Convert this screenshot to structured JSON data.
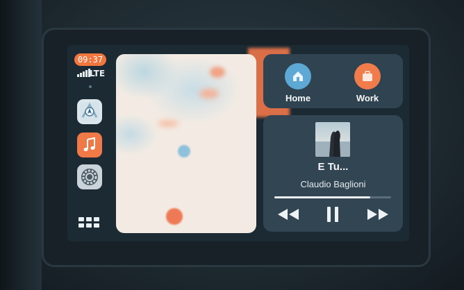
{
  "status": {
    "time": "09:37",
    "network": "LTE"
  },
  "dock": {
    "apps": [
      {
        "name": "Maps",
        "icon": "maps-icon"
      },
      {
        "name": "Music",
        "icon": "music-note-icon"
      },
      {
        "name": "Settings",
        "icon": "gear-icon"
      }
    ],
    "app_grid_icon": "grid-icon"
  },
  "destinations": {
    "home_label": "Home",
    "work_label": "Work"
  },
  "now_playing": {
    "title": "E Tu...",
    "artist": "Claudio Baglioni",
    "progress": 0.82
  },
  "colors": {
    "accent": "#f2773f",
    "home": "#5da8d4",
    "work": "#f07c4b",
    "panel": "#324552"
  }
}
